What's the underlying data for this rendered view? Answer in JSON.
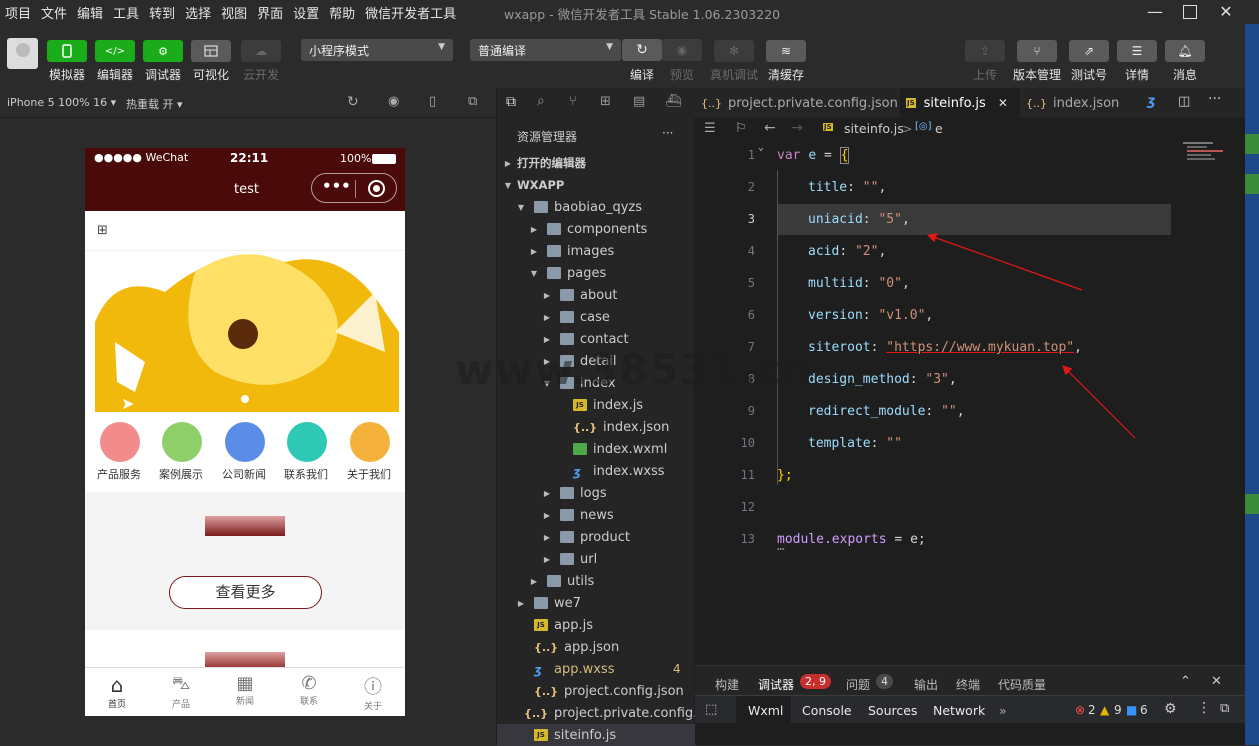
{
  "menu": [
    "项目",
    "文件",
    "编辑",
    "工具",
    "转到",
    "选择",
    "视图",
    "界面",
    "设置",
    "帮助",
    "微信开发者工具"
  ],
  "window_title": "wxapp - 微信开发者工具 Stable 1.06.2303220",
  "toolbar": {
    "simulator": "模拟器",
    "editor": "编辑器",
    "debugger": "调试器",
    "visual": "可视化",
    "cloud": "云开发",
    "mode_select": "小程序模式",
    "compile_select": "普通编译",
    "compile": "编译",
    "preview": "预览",
    "realdebug": "真机调试",
    "clearcache": "清缓存",
    "upload": "上传",
    "version": "版本管理",
    "testid": "测试号",
    "details": "详情",
    "messages": "消息"
  },
  "simbar": {
    "device": "iPhone 5 100% 16",
    "hotreload": "热重载 开"
  },
  "phone": {
    "status_signal": "●●●●● WeChat",
    "status_time": "22:11",
    "status_battery": "100%",
    "nav_title": "test",
    "nav_dots": "•••",
    "grid_items": [
      "产品服务",
      "案例展示",
      "公司新闻",
      "联系我们",
      "关于我们"
    ],
    "more_button": "查看更多",
    "tabbar": [
      "首页",
      "产品",
      "新闻",
      "联系",
      "关于"
    ]
  },
  "explorer": {
    "title": "资源管理器",
    "more": "···",
    "open_editors": "打开的编辑器",
    "root": "WXAPP",
    "items": [
      {
        "label": "baobiao_qyzs",
        "type": "folder",
        "depth": 1,
        "open": true
      },
      {
        "label": "components",
        "type": "folder",
        "depth": 2,
        "open": false
      },
      {
        "label": "images",
        "type": "folder",
        "depth": 2,
        "open": false
      },
      {
        "label": "pages",
        "type": "folder",
        "depth": 2,
        "open": true
      },
      {
        "label": "about",
        "type": "folder",
        "depth": 3,
        "open": false
      },
      {
        "label": "case",
        "type": "folder",
        "depth": 3,
        "open": false
      },
      {
        "label": "contact",
        "type": "folder",
        "depth": 3,
        "open": false
      },
      {
        "label": "detail",
        "type": "folder",
        "depth": 3,
        "open": false
      },
      {
        "label": "index",
        "type": "folder",
        "depth": 3,
        "open": true
      },
      {
        "label": "index.js",
        "type": "js",
        "depth": 4
      },
      {
        "label": "index.json",
        "type": "json",
        "depth": 4
      },
      {
        "label": "index.wxml",
        "type": "wxml",
        "depth": 4
      },
      {
        "label": "index.wxss",
        "type": "wxss",
        "depth": 4
      },
      {
        "label": "logs",
        "type": "folder",
        "depth": 3,
        "open": false
      },
      {
        "label": "news",
        "type": "folder",
        "depth": 3,
        "open": false
      },
      {
        "label": "product",
        "type": "folder",
        "depth": 3,
        "open": false
      },
      {
        "label": "url",
        "type": "folder",
        "depth": 3,
        "open": false
      },
      {
        "label": "utils",
        "type": "folder",
        "depth": 2,
        "open": false
      },
      {
        "label": "we7",
        "type": "folder",
        "depth": 1,
        "open": false
      },
      {
        "label": "app.js",
        "type": "js",
        "depth": 1
      },
      {
        "label": "app.json",
        "type": "json",
        "depth": 1
      },
      {
        "label": "app.wxss",
        "type": "wxss",
        "depth": 1,
        "badge": "4"
      },
      {
        "label": "project.config.json",
        "type": "json",
        "depth": 1
      },
      {
        "label": "project.private.config.js...",
        "type": "json",
        "depth": 1
      },
      {
        "label": "siteinfo.js",
        "type": "js",
        "depth": 1,
        "selected": true
      }
    ]
  },
  "tabs": [
    {
      "label": "project.private.config.json",
      "icon": "{..}"
    },
    {
      "label": "siteinfo.js",
      "icon": "JS",
      "active": true,
      "close": "✕"
    },
    {
      "label": "index.json",
      "icon": "{..}"
    }
  ],
  "breadcrumb": {
    "file": "siteinfo.js",
    "sep": ">",
    "symbol": "e"
  },
  "code": {
    "line_numbers": [
      "1",
      "2",
      "3",
      "4",
      "5",
      "6",
      "7",
      "8",
      "9",
      "10",
      "11",
      "12",
      "13"
    ],
    "l1": {
      "kw": "var",
      "name": "e",
      "eq": "=",
      "brace": "{"
    },
    "fields": [
      {
        "key": "title",
        "val": "\"\""
      },
      {
        "key": "uniacid",
        "val": "\"5\""
      },
      {
        "key": "acid",
        "val": "\"2\""
      },
      {
        "key": "multiid",
        "val": "\"0\""
      },
      {
        "key": "version",
        "val": "\"v1.0\""
      },
      {
        "key": "siteroot",
        "val": "\"https://www.mykuan.top\""
      },
      {
        "key": "design_method",
        "val": "\"3\""
      },
      {
        "key": "redirect_module",
        "val": "\"\""
      },
      {
        "key": "template",
        "val": "\"\""
      }
    ],
    "l11": "};",
    "l13_a": "module",
    "l13_b": ".exports",
    "l13_c": " = e;"
  },
  "panel": {
    "tabs": [
      "构建",
      "调试器",
      "问题",
      "输出",
      "终端",
      "代码质量"
    ],
    "debugger_badge": "2, 9",
    "problems_badge": "4",
    "devtools_tabs": [
      "Wxml",
      "Console",
      "Sources",
      "Network"
    ],
    "errors": "2",
    "warnings": "9",
    "infos": "6"
  },
  "watermark": "www.38531.cn",
  "colors": {
    "accent_green": "#1aad19",
    "nav_bg": "#4a0a0a",
    "arrow": "#e01818"
  }
}
